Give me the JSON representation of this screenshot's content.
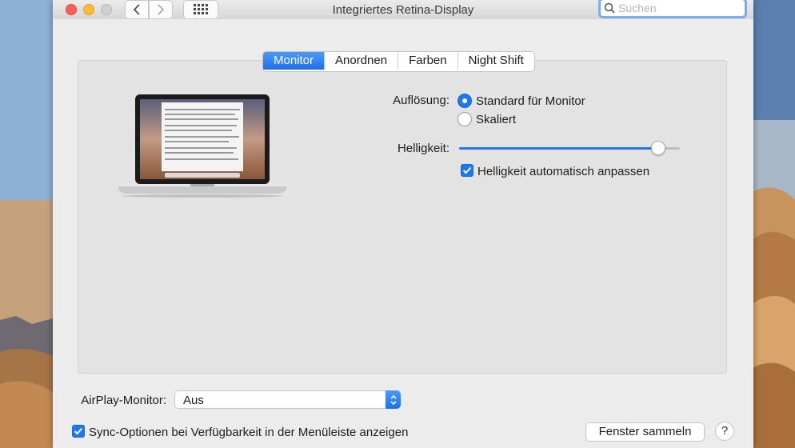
{
  "window": {
    "title": "Integriertes Retina-Display",
    "search_placeholder": "Suchen"
  },
  "tabs": [
    {
      "label": "Monitor",
      "active": true
    },
    {
      "label": "Anordnen",
      "active": false
    },
    {
      "label": "Farben",
      "active": false
    },
    {
      "label": "Night Shift",
      "active": false
    }
  ],
  "display": {
    "resolution_label": "Auflösung:",
    "resolution_options": [
      {
        "label": "Standard für Monitor",
        "selected": true
      },
      {
        "label": "Skaliert",
        "selected": false
      }
    ],
    "brightness_label": "Helligkeit:",
    "brightness_level": 0.93,
    "auto_brightness_label": "Helligkeit automatisch anpassen",
    "auto_brightness_checked": true
  },
  "footer": {
    "airplay_label": "AirPlay-Monitor:",
    "airplay_value": "Aus",
    "sync_label": "Sync-Optionen bei Verfügbarkeit in der Menüleiste anzeigen",
    "sync_checked": true,
    "gather_button": "Fenster sammeln",
    "help_button": "?"
  },
  "colors": {
    "accent": "#1e76f1",
    "close": "#fc5f57",
    "minimize": "#fdbc2e"
  }
}
